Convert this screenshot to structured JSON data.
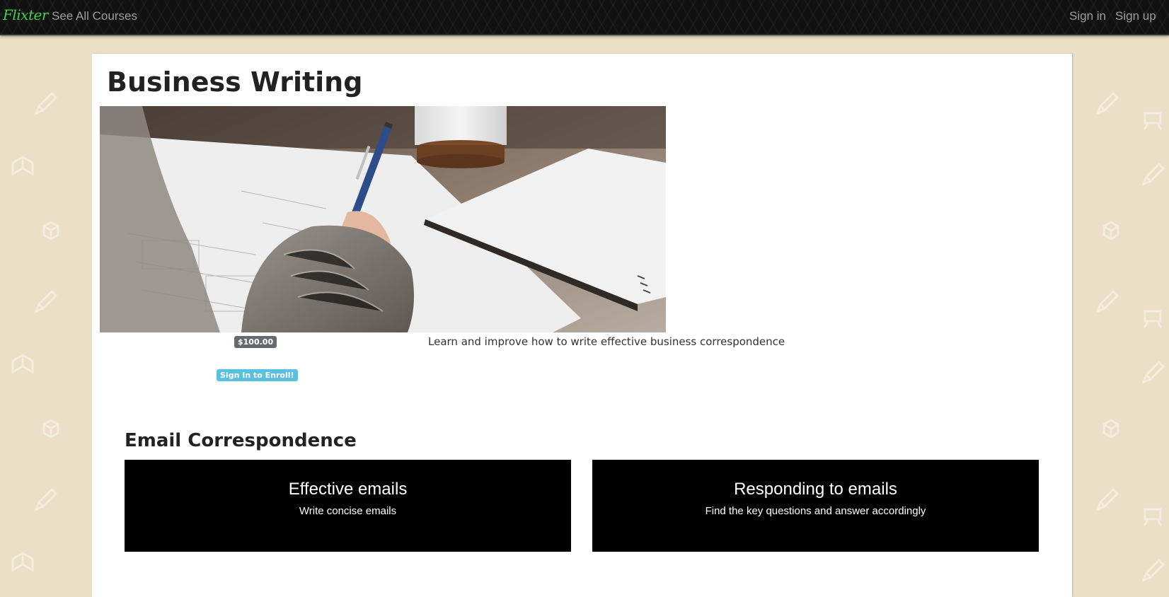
{
  "navbar": {
    "brand": "Flixter",
    "courses_link": "See All Courses",
    "sign_in": "Sign in",
    "sign_up": "Sign up"
  },
  "course": {
    "title": "Business Writing",
    "price": "$100.00",
    "description": "Learn and improve how to write effective business correspondence",
    "enroll_label": "Sign In to Enroll!"
  },
  "section": {
    "title": "Email Correspondence",
    "lessons": [
      {
        "title": "Effective emails",
        "subtitle": "Write concise emails"
      },
      {
        "title": "Responding to emails",
        "subtitle": "Find the key questions and answer accordingly"
      }
    ]
  },
  "colors": {
    "page_bg": "#ebdfc7",
    "navbar_bg": "#111111",
    "brand": "#3fd14a",
    "price_badge": "#666a6e",
    "enroll_button": "#5bc0de",
    "lesson_card": "#000000"
  },
  "icons": [
    "pencil-icon",
    "book-icon",
    "cube-icon",
    "chalkboard-icon"
  ]
}
